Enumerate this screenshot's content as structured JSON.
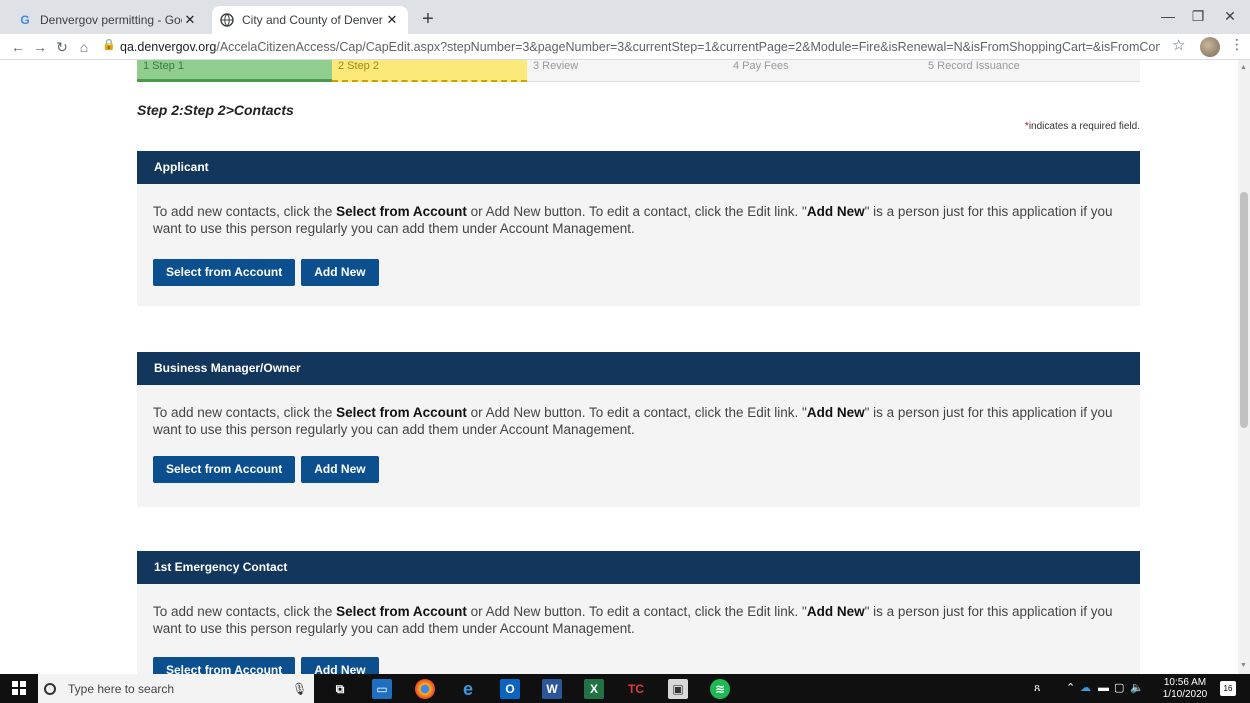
{
  "browser": {
    "tabs": [
      {
        "title": "Denvergov permitting - Google S",
        "favicon": "G",
        "active": false
      },
      {
        "title": "City and County of Denver | ePer",
        "favicon": "globe-icon",
        "active": true
      }
    ],
    "url_host": "qa.denvergov.org",
    "url_path": "/AccelaCitizenAccess/Cap/CapEdit.aspx?stepNumber=3&pageNumber=3&currentStep=1&currentPage=2&Module=Fire&isRenewal=N&isFromShoppingCart=&isFromConfirmPage=..."
  },
  "steps": [
    {
      "label": "1 Step 1"
    },
    {
      "label": "2 Step 2"
    },
    {
      "label": "3 Review"
    },
    {
      "label": "4 Pay Fees"
    },
    {
      "label": "5 Record Issuance"
    }
  ],
  "page": {
    "section_title": "Step 2:Step 2>Contacts",
    "required_mark": "*",
    "required_text": "indicates a required field."
  },
  "contact_blocks": [
    {
      "title": "Applicant"
    },
    {
      "title": "Business Manager/Owner"
    },
    {
      "title": "1st Emergency Contact"
    }
  ],
  "instructions": {
    "part1": "To add new contacts, click the ",
    "select_bold": "Select from Account",
    "part2": " or Add New button. To edit a contact, click the Edit link.    \"",
    "addnew_bold": "Add New",
    "part3": "\" is a person just for this application if you want to use this person regularly you can add them under Account Management."
  },
  "buttons": {
    "select_from_account": "Select from Account",
    "add_new": "Add New"
  },
  "taskbar": {
    "search_placeholder": "Type here to search",
    "time": "10:56 AM",
    "date": "1/10/2020",
    "notifications": "16"
  }
}
